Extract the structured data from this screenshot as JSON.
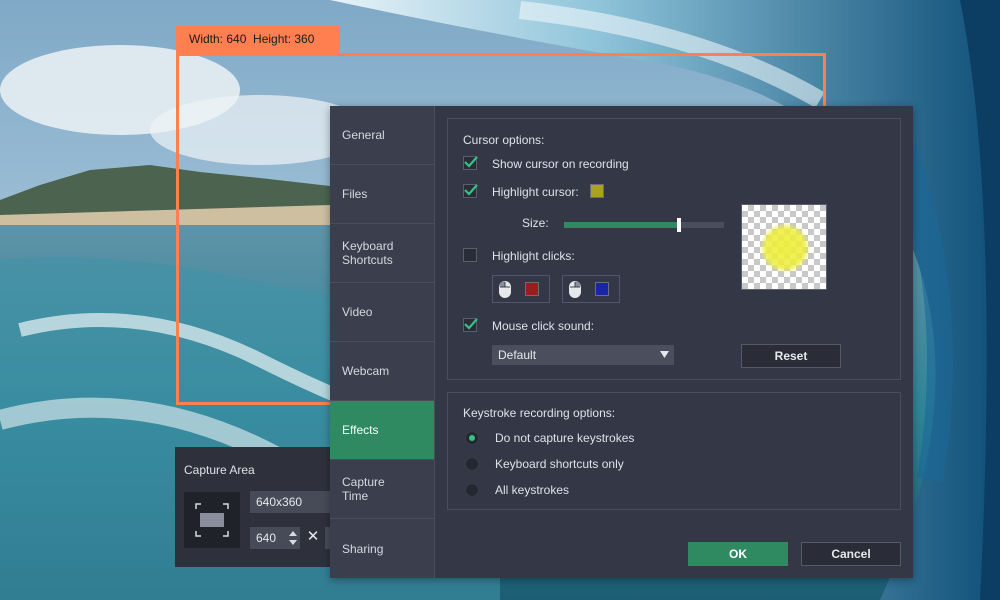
{
  "capture_overlay": {
    "dimensions_label": "Width: 640  Height: 360"
  },
  "capture_area": {
    "title": "Capture Area",
    "preset_value": "640x360",
    "width_value": "640",
    "times_glyph": "✕"
  },
  "settings": {
    "nav": [
      {
        "id": "general",
        "label": "General",
        "active": false
      },
      {
        "id": "files",
        "label": "Files",
        "active": false
      },
      {
        "id": "keyboard-shortcuts",
        "label": "Keyboard Shortcuts",
        "active": false
      },
      {
        "id": "video",
        "label": "Video",
        "active": false
      },
      {
        "id": "webcam",
        "label": "Webcam",
        "active": false
      },
      {
        "id": "effects",
        "label": "Effects",
        "active": true
      },
      {
        "id": "capture-time",
        "label": "Capture Time",
        "active": false
      },
      {
        "id": "sharing",
        "label": "Sharing",
        "active": false
      }
    ],
    "cursor_options": {
      "title": "Cursor options:",
      "show_cursor": {
        "label": "Show cursor on recording",
        "checked": true
      },
      "highlight_cursor": {
        "label": "Highlight cursor:",
        "checked": true,
        "color": "#a8a21c"
      },
      "size": {
        "label": "Size:",
        "value_fraction": 0.72
      },
      "highlight_clicks": {
        "label": "Highlight clicks:",
        "checked": false,
        "left_click_color": "#9b1c1c",
        "right_click_color": "#1a24a8"
      },
      "mouse_click_sound": {
        "label": "Mouse click sound:",
        "checked": true,
        "selected": "Default"
      },
      "reset_label": "Reset"
    },
    "keystroke_options": {
      "title": "Keystroke recording options:",
      "options": [
        {
          "label": "Do not capture keystrokes",
          "selected": true
        },
        {
          "label": "Keyboard shortcuts only",
          "selected": false
        },
        {
          "label": "All keystrokes",
          "selected": false
        }
      ]
    },
    "ok_label": "OK",
    "cancel_label": "Cancel"
  },
  "colors": {
    "accent": "#2f8a61",
    "frame": "#ff7f50",
    "checkmark": "#34c384"
  }
}
